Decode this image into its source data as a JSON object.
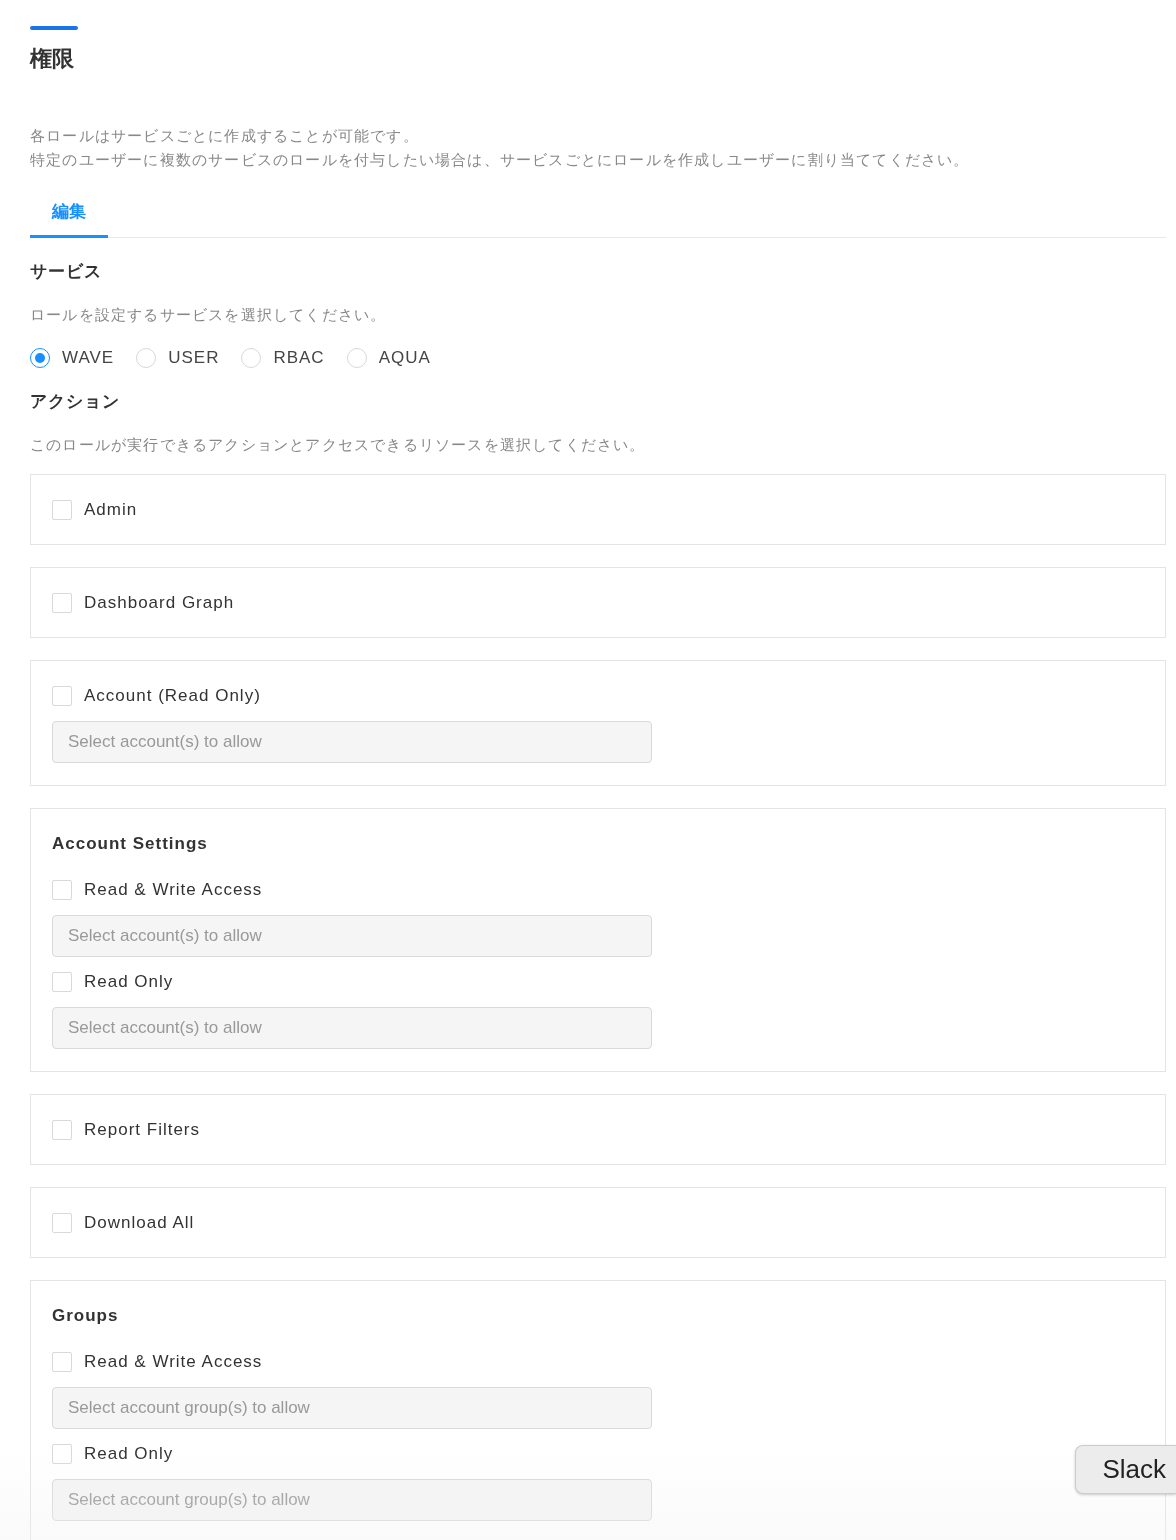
{
  "title": "権限",
  "description": [
    "各ロールはサービスごとに作成することが可能です。",
    "特定のユーザーに複数のサービスのロールを付与したい場合は、サービスごとにロールを作成しユーザーに割り当ててください。"
  ],
  "tabs": [
    {
      "label": "編集",
      "selected": true
    }
  ],
  "service": {
    "heading": "サービス",
    "hint": "ロールを設定するサービスを選択してください。",
    "options": [
      {
        "label": "WAVE",
        "selected": true
      },
      {
        "label": "USER",
        "selected": false
      },
      {
        "label": "RBAC",
        "selected": false
      },
      {
        "label": "AQUA",
        "selected": false
      }
    ]
  },
  "actions": {
    "heading": "アクション",
    "hint": "このロールが実行できるアクションとアクセスできるリソースを選択してください。",
    "cards": [
      {
        "kind": "single",
        "options": [
          {
            "label": "Admin",
            "checked": false
          }
        ]
      },
      {
        "kind": "single",
        "options": [
          {
            "label": "Dashboard Graph",
            "checked": false
          }
        ]
      },
      {
        "kind": "single",
        "options": [
          {
            "label": "Account (Read Only)",
            "checked": false,
            "placeholder": "Select account(s) to allow"
          }
        ]
      },
      {
        "kind": "group",
        "title": "Account Settings",
        "options": [
          {
            "label": "Read & Write Access",
            "checked": false,
            "placeholder": "Select account(s) to allow"
          },
          {
            "label": "Read Only",
            "checked": false,
            "placeholder": "Select account(s) to allow"
          }
        ]
      },
      {
        "kind": "single",
        "options": [
          {
            "label": "Report Filters",
            "checked": false
          }
        ]
      },
      {
        "kind": "single",
        "options": [
          {
            "label": "Download All",
            "checked": false
          }
        ]
      },
      {
        "kind": "group",
        "title": "Groups",
        "options": [
          {
            "label": "Read & Write Access",
            "checked": false,
            "placeholder": "Select account group(s) to allow"
          },
          {
            "label": "Read Only",
            "checked": false,
            "placeholder": "Select account group(s) to allow"
          }
        ]
      }
    ]
  },
  "tooltip": {
    "text": "Slack"
  }
}
